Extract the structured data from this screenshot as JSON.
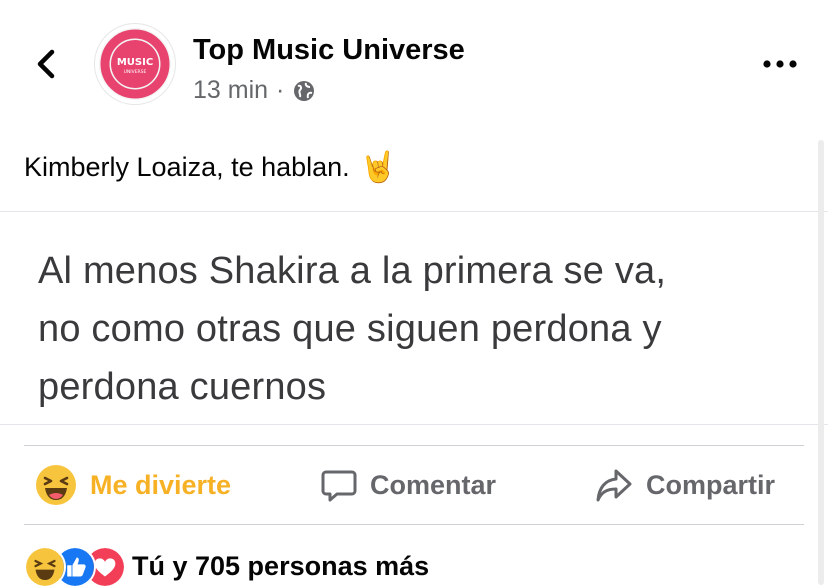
{
  "header": {
    "page_name": "Top Music Universe",
    "avatar_text": "MUSIC",
    "avatar_subtext": "UNIVERSE",
    "time": "13 min",
    "separator": "·",
    "privacy_icon": "globe-icon",
    "back_icon": "chevron-left-icon",
    "more_icon": "more-horizontal-icon"
  },
  "post": {
    "text": "Kimberly Loaiza, te hablan.",
    "emoji": "🤘"
  },
  "tweet_image": {
    "lines": [
      "Al menos Shakira a la primera se va,",
      "no como otras que siguen perdona y",
      "perdona cuernos"
    ]
  },
  "actions": {
    "react_label": "Me divierte",
    "comment_label": "Comentar",
    "share_label": "Compartir"
  },
  "reactions": {
    "summary": "Tú y 705 personas más",
    "types": [
      "haha",
      "like",
      "love"
    ]
  },
  "colors": {
    "accent_haha": "#f7b125",
    "like_blue": "#1877f2",
    "love_red": "#f33e58",
    "avatar_pink": "#e8436f",
    "muted": "#65676b"
  }
}
